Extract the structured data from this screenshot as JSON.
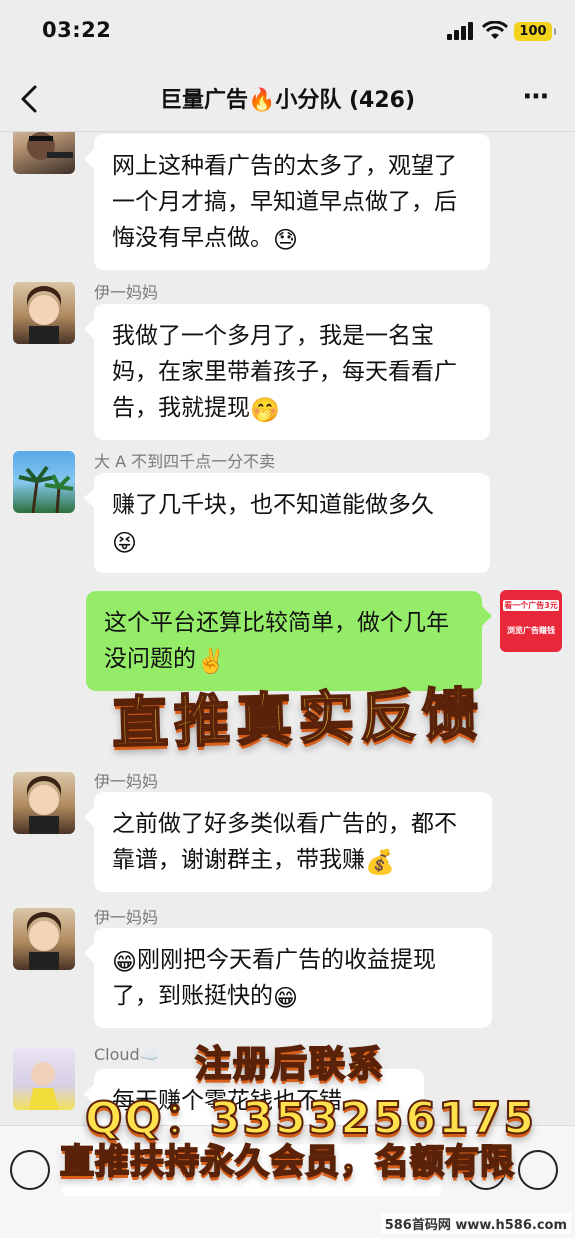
{
  "status_bar": {
    "time": "03:22",
    "battery": "100"
  },
  "header": {
    "title": "巨量广告🔥小分队 (426)",
    "more_icon": "⋯"
  },
  "messages": [
    {
      "sender": "",
      "text": "网上这种看广告的太多了，观望了一个月才搞，早知道早点做了，后悔没有早点做。",
      "emoji": "😓"
    },
    {
      "sender": "伊一妈妈",
      "text": "我做了一个多月了，我是一名宝妈，在家里带着孩子，每天看看广告，我就提现",
      "emoji": "🤭"
    },
    {
      "sender": "大 A 不到四千点一分不卖",
      "text": "赚了几千块，也不知道能做多久",
      "emoji": "😝"
    },
    {
      "sender": "",
      "text": "这个平台还算比较简单，做个几年没问题的",
      "emoji": "✌️"
    },
    {
      "sender": "伊一妈妈",
      "text": "之前做了好多类似看广告的，都不靠谱，谢谢群主，带我赚",
      "emoji": "💰"
    },
    {
      "sender": "伊一妈妈",
      "emoji_pre": "😁",
      "text": "刚刚把今天看广告的收益提现了，到账挺快的",
      "emoji": "😁"
    },
    {
      "sender": "Cloud☁️",
      "text": "每天赚个零花钱也不错"
    }
  ],
  "small_ad": {
    "line1": "看一个广告3元",
    "line2": "浏览广告赚钱"
  },
  "banners": {
    "main": "直推真实反馈",
    "register": "注册后联系",
    "qq": "QQ：3353256175",
    "vip": "直推扶持永久会员，名额有限"
  },
  "watermark": "586首码网 www.h586.com",
  "colors": {
    "self_bubble": "#95ec69",
    "other_bubble": "#ffffff",
    "banner_fill": "#ffe14d",
    "background": "#ededed"
  }
}
